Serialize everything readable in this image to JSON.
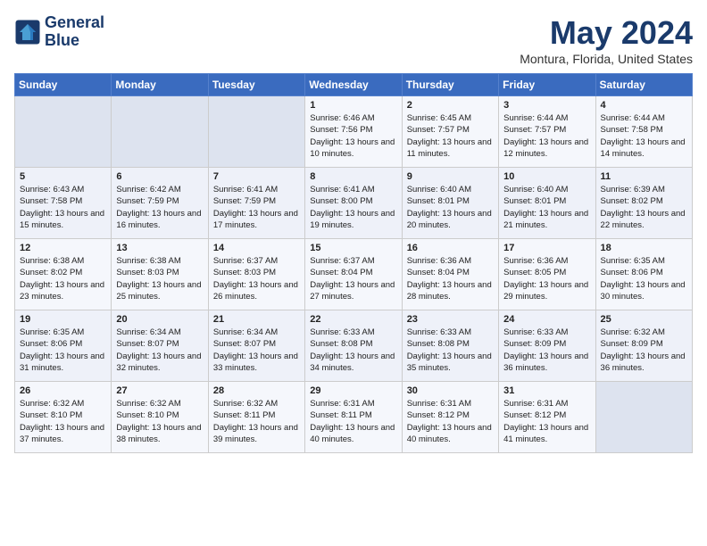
{
  "header": {
    "logo_line1": "General",
    "logo_line2": "Blue",
    "month": "May 2024",
    "location": "Montura, Florida, United States"
  },
  "weekdays": [
    "Sunday",
    "Monday",
    "Tuesday",
    "Wednesday",
    "Thursday",
    "Friday",
    "Saturday"
  ],
  "weeks": [
    [
      {
        "day": "",
        "info": ""
      },
      {
        "day": "",
        "info": ""
      },
      {
        "day": "",
        "info": ""
      },
      {
        "day": "1",
        "info": "Sunrise: 6:46 AM\nSunset: 7:56 PM\nDaylight: 13 hours\nand 10 minutes."
      },
      {
        "day": "2",
        "info": "Sunrise: 6:45 AM\nSunset: 7:57 PM\nDaylight: 13 hours\nand 11 minutes."
      },
      {
        "day": "3",
        "info": "Sunrise: 6:44 AM\nSunset: 7:57 PM\nDaylight: 13 hours\nand 12 minutes."
      },
      {
        "day": "4",
        "info": "Sunrise: 6:44 AM\nSunset: 7:58 PM\nDaylight: 13 hours\nand 14 minutes."
      }
    ],
    [
      {
        "day": "5",
        "info": "Sunrise: 6:43 AM\nSunset: 7:58 PM\nDaylight: 13 hours\nand 15 minutes."
      },
      {
        "day": "6",
        "info": "Sunrise: 6:42 AM\nSunset: 7:59 PM\nDaylight: 13 hours\nand 16 minutes."
      },
      {
        "day": "7",
        "info": "Sunrise: 6:41 AM\nSunset: 7:59 PM\nDaylight: 13 hours\nand 17 minutes."
      },
      {
        "day": "8",
        "info": "Sunrise: 6:41 AM\nSunset: 8:00 PM\nDaylight: 13 hours\nand 19 minutes."
      },
      {
        "day": "9",
        "info": "Sunrise: 6:40 AM\nSunset: 8:01 PM\nDaylight: 13 hours\nand 20 minutes."
      },
      {
        "day": "10",
        "info": "Sunrise: 6:40 AM\nSunset: 8:01 PM\nDaylight: 13 hours\nand 21 minutes."
      },
      {
        "day": "11",
        "info": "Sunrise: 6:39 AM\nSunset: 8:02 PM\nDaylight: 13 hours\nand 22 minutes."
      }
    ],
    [
      {
        "day": "12",
        "info": "Sunrise: 6:38 AM\nSunset: 8:02 PM\nDaylight: 13 hours\nand 23 minutes."
      },
      {
        "day": "13",
        "info": "Sunrise: 6:38 AM\nSunset: 8:03 PM\nDaylight: 13 hours\nand 25 minutes."
      },
      {
        "day": "14",
        "info": "Sunrise: 6:37 AM\nSunset: 8:03 PM\nDaylight: 13 hours\nand 26 minutes."
      },
      {
        "day": "15",
        "info": "Sunrise: 6:37 AM\nSunset: 8:04 PM\nDaylight: 13 hours\nand 27 minutes."
      },
      {
        "day": "16",
        "info": "Sunrise: 6:36 AM\nSunset: 8:04 PM\nDaylight: 13 hours\nand 28 minutes."
      },
      {
        "day": "17",
        "info": "Sunrise: 6:36 AM\nSunset: 8:05 PM\nDaylight: 13 hours\nand 29 minutes."
      },
      {
        "day": "18",
        "info": "Sunrise: 6:35 AM\nSunset: 8:06 PM\nDaylight: 13 hours\nand 30 minutes."
      }
    ],
    [
      {
        "day": "19",
        "info": "Sunrise: 6:35 AM\nSunset: 8:06 PM\nDaylight: 13 hours\nand 31 minutes."
      },
      {
        "day": "20",
        "info": "Sunrise: 6:34 AM\nSunset: 8:07 PM\nDaylight: 13 hours\nand 32 minutes."
      },
      {
        "day": "21",
        "info": "Sunrise: 6:34 AM\nSunset: 8:07 PM\nDaylight: 13 hours\nand 33 minutes."
      },
      {
        "day": "22",
        "info": "Sunrise: 6:33 AM\nSunset: 8:08 PM\nDaylight: 13 hours\nand 34 minutes."
      },
      {
        "day": "23",
        "info": "Sunrise: 6:33 AM\nSunset: 8:08 PM\nDaylight: 13 hours\nand 35 minutes."
      },
      {
        "day": "24",
        "info": "Sunrise: 6:33 AM\nSunset: 8:09 PM\nDaylight: 13 hours\nand 36 minutes."
      },
      {
        "day": "25",
        "info": "Sunrise: 6:32 AM\nSunset: 8:09 PM\nDaylight: 13 hours\nand 36 minutes."
      }
    ],
    [
      {
        "day": "26",
        "info": "Sunrise: 6:32 AM\nSunset: 8:10 PM\nDaylight: 13 hours\nand 37 minutes."
      },
      {
        "day": "27",
        "info": "Sunrise: 6:32 AM\nSunset: 8:10 PM\nDaylight: 13 hours\nand 38 minutes."
      },
      {
        "day": "28",
        "info": "Sunrise: 6:32 AM\nSunset: 8:11 PM\nDaylight: 13 hours\nand 39 minutes."
      },
      {
        "day": "29",
        "info": "Sunrise: 6:31 AM\nSunset: 8:11 PM\nDaylight: 13 hours\nand 40 minutes."
      },
      {
        "day": "30",
        "info": "Sunrise: 6:31 AM\nSunset: 8:12 PM\nDaylight: 13 hours\nand 40 minutes."
      },
      {
        "day": "31",
        "info": "Sunrise: 6:31 AM\nSunset: 8:12 PM\nDaylight: 13 hours\nand 41 minutes."
      },
      {
        "day": "",
        "info": ""
      }
    ]
  ]
}
